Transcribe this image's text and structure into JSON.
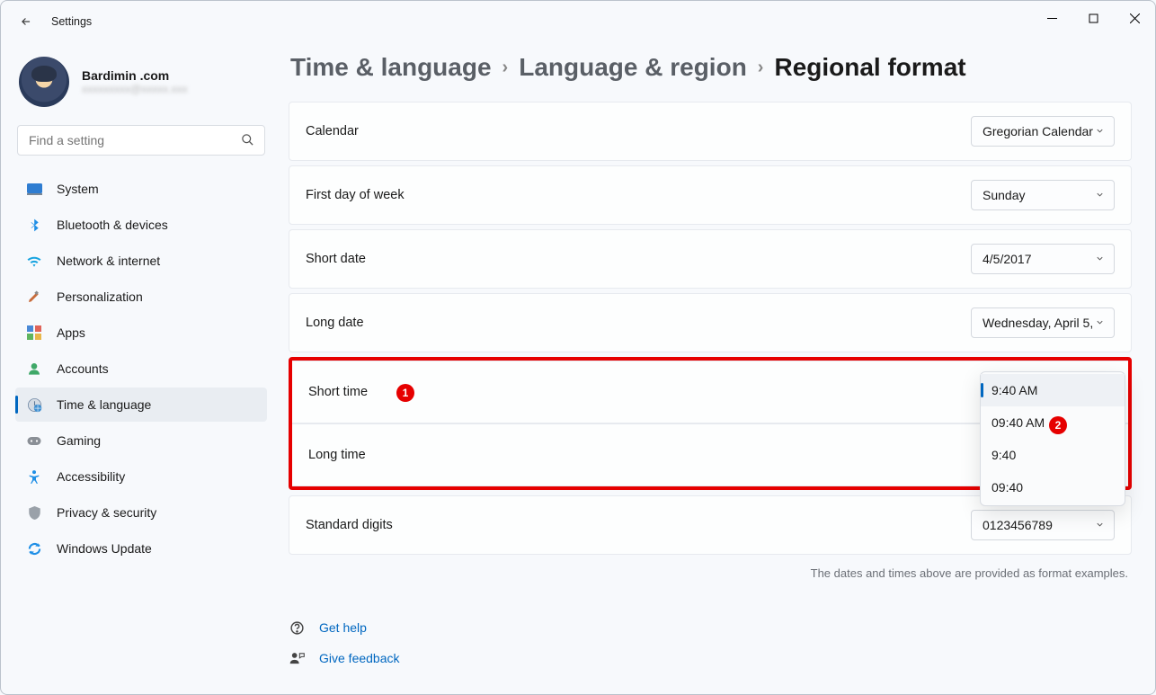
{
  "window": {
    "title": "Settings"
  },
  "profile": {
    "name": "Bardimin .com",
    "email": "xxxxxxxxx@xxxxx.xxx"
  },
  "search": {
    "placeholder": "Find a setting"
  },
  "nav": {
    "items": [
      {
        "label": "System"
      },
      {
        "label": "Bluetooth & devices"
      },
      {
        "label": "Network & internet"
      },
      {
        "label": "Personalization"
      },
      {
        "label": "Apps"
      },
      {
        "label": "Accounts"
      },
      {
        "label": "Time & language"
      },
      {
        "label": "Gaming"
      },
      {
        "label": "Accessibility"
      },
      {
        "label": "Privacy & security"
      },
      {
        "label": "Windows Update"
      }
    ]
  },
  "breadcrumb": {
    "a": "Time & language",
    "b": "Language & region",
    "c": "Regional format"
  },
  "settings": {
    "calendar": {
      "label": "Calendar",
      "value": "Gregorian Calendar"
    },
    "firstday": {
      "label": "First day of week",
      "value": "Sunday"
    },
    "shortdate": {
      "label": "Short date",
      "value": "4/5/2017"
    },
    "longdate": {
      "label": "Long date",
      "value": "Wednesday, April 5,"
    },
    "shorttime": {
      "label": "Short time"
    },
    "longtime": {
      "label": "Long time"
    },
    "digits": {
      "label": "Standard digits",
      "value": "0123456789"
    }
  },
  "dropdown": {
    "options": [
      "9:40 AM",
      "09:40 AM",
      "9:40",
      "09:40"
    ]
  },
  "badges": {
    "one": "1",
    "two": "2"
  },
  "note": "The dates and times above are provided as format examples.",
  "help": {
    "gethelp": "Get help",
    "feedback": "Give feedback"
  }
}
